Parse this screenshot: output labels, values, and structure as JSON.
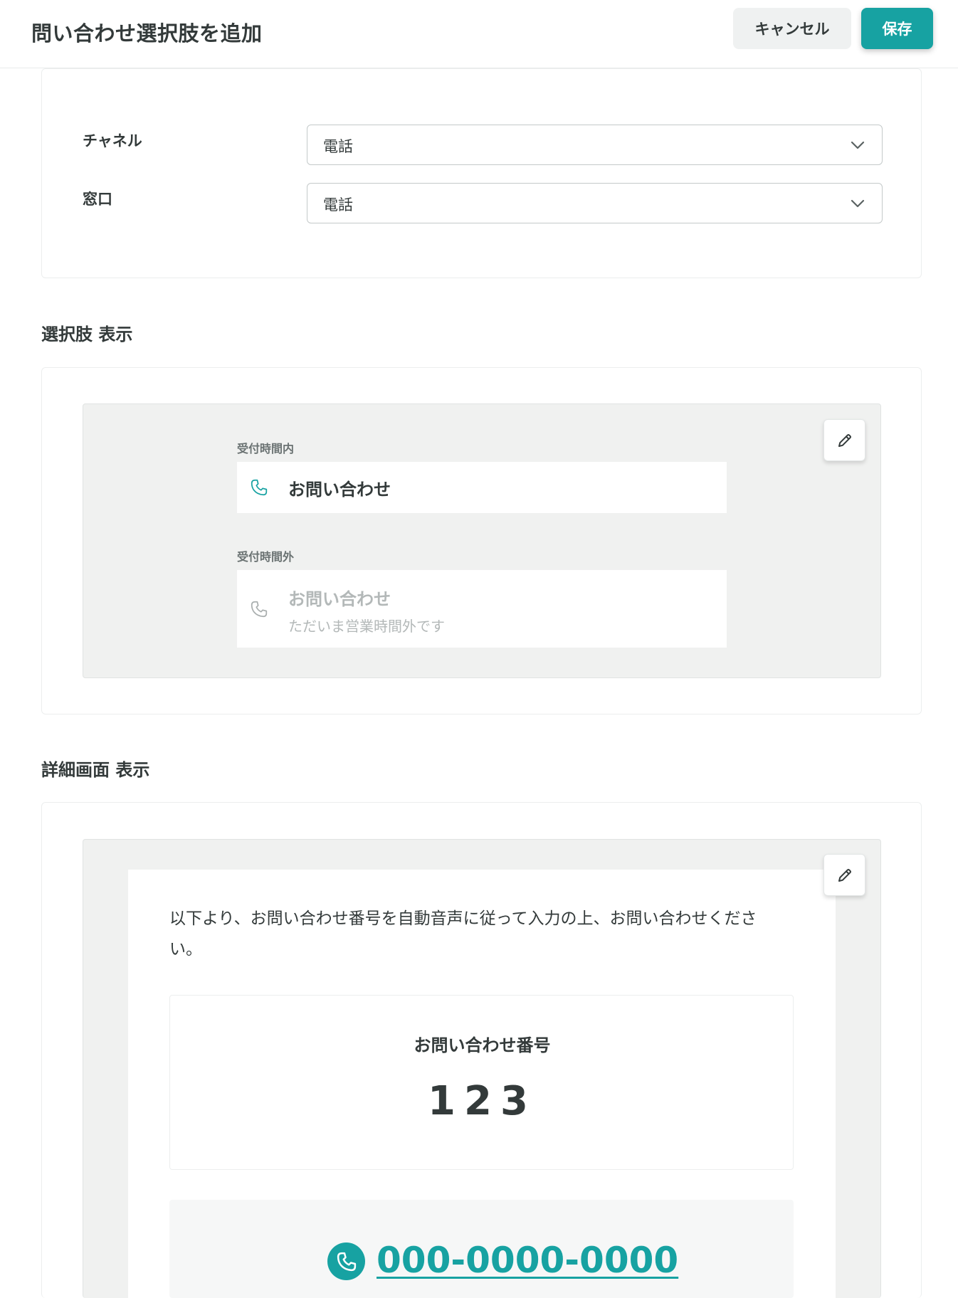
{
  "header": {
    "title": "問い合わせ選択肢を追加",
    "cancel_label": "キャンセル",
    "save_label": "保存"
  },
  "form": {
    "channel": {
      "label": "チャネル",
      "value": "電話"
    },
    "window": {
      "label": "窓口",
      "value": "電話"
    }
  },
  "option_display": {
    "section_title": "選択肢 表示",
    "in_hours": {
      "label": "受付時間内",
      "title": "お問い合わせ"
    },
    "out_hours": {
      "label": "受付時間外",
      "title": "お問い合わせ",
      "subtitle": "ただいま営業時間外です"
    }
  },
  "detail_display": {
    "section_title": "詳細画面 表示",
    "description": "以下より、お問い合わせ番号を自動音声に従って入力の上、お問い合わせください。",
    "inquiry_number_label": "お問い合わせ番号",
    "inquiry_number": "123",
    "phone_number": "000-0000-0000"
  },
  "colors": {
    "accent": "#17a2a2",
    "text": "#333a3a",
    "muted": "#b3b8b8",
    "preview_bg": "#f0f1f0"
  },
  "icons": {
    "select_arrow": "chevron-down-icon",
    "edit": "pencil-icon",
    "phone": "phone-icon"
  }
}
